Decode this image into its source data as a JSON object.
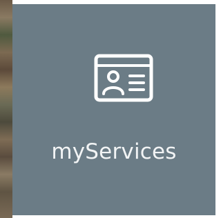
{
  "tile": {
    "label": "myServices",
    "icon": "id-card-icon",
    "background_color": "#6b7c86",
    "foreground_color": "#ffffff"
  }
}
